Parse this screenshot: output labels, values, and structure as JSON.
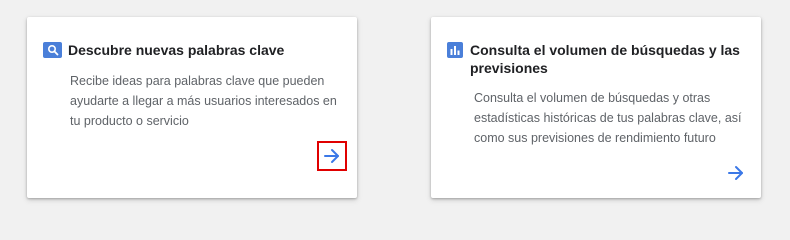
{
  "cards": [
    {
      "title": "Descubre nuevas palabras clave",
      "description": "Recibe ideas para palabras clave que pueden ayudarte a llegar a más usuarios interesados en tu producto o servicio",
      "icon": "search-icon",
      "action_icon": "arrow-right-icon",
      "highlighted": true,
      "highlight_color": "#e00000"
    },
    {
      "title": "Consulta el volumen de búsquedas y las previsiones",
      "description": "Consulta el volumen de búsquedas y otras estadísticas históricas de tus palabras clave, así como sus previsiones de rendimiento futuro",
      "icon": "bar-chart-icon",
      "action_icon": "arrow-right-icon",
      "highlighted": false
    }
  ],
  "colors": {
    "accent": "#4a7fd9",
    "arrow": "#3b78e7",
    "background": "#f1f1f1",
    "card": "#ffffff",
    "title": "#202124",
    "text": "#5f6368"
  }
}
